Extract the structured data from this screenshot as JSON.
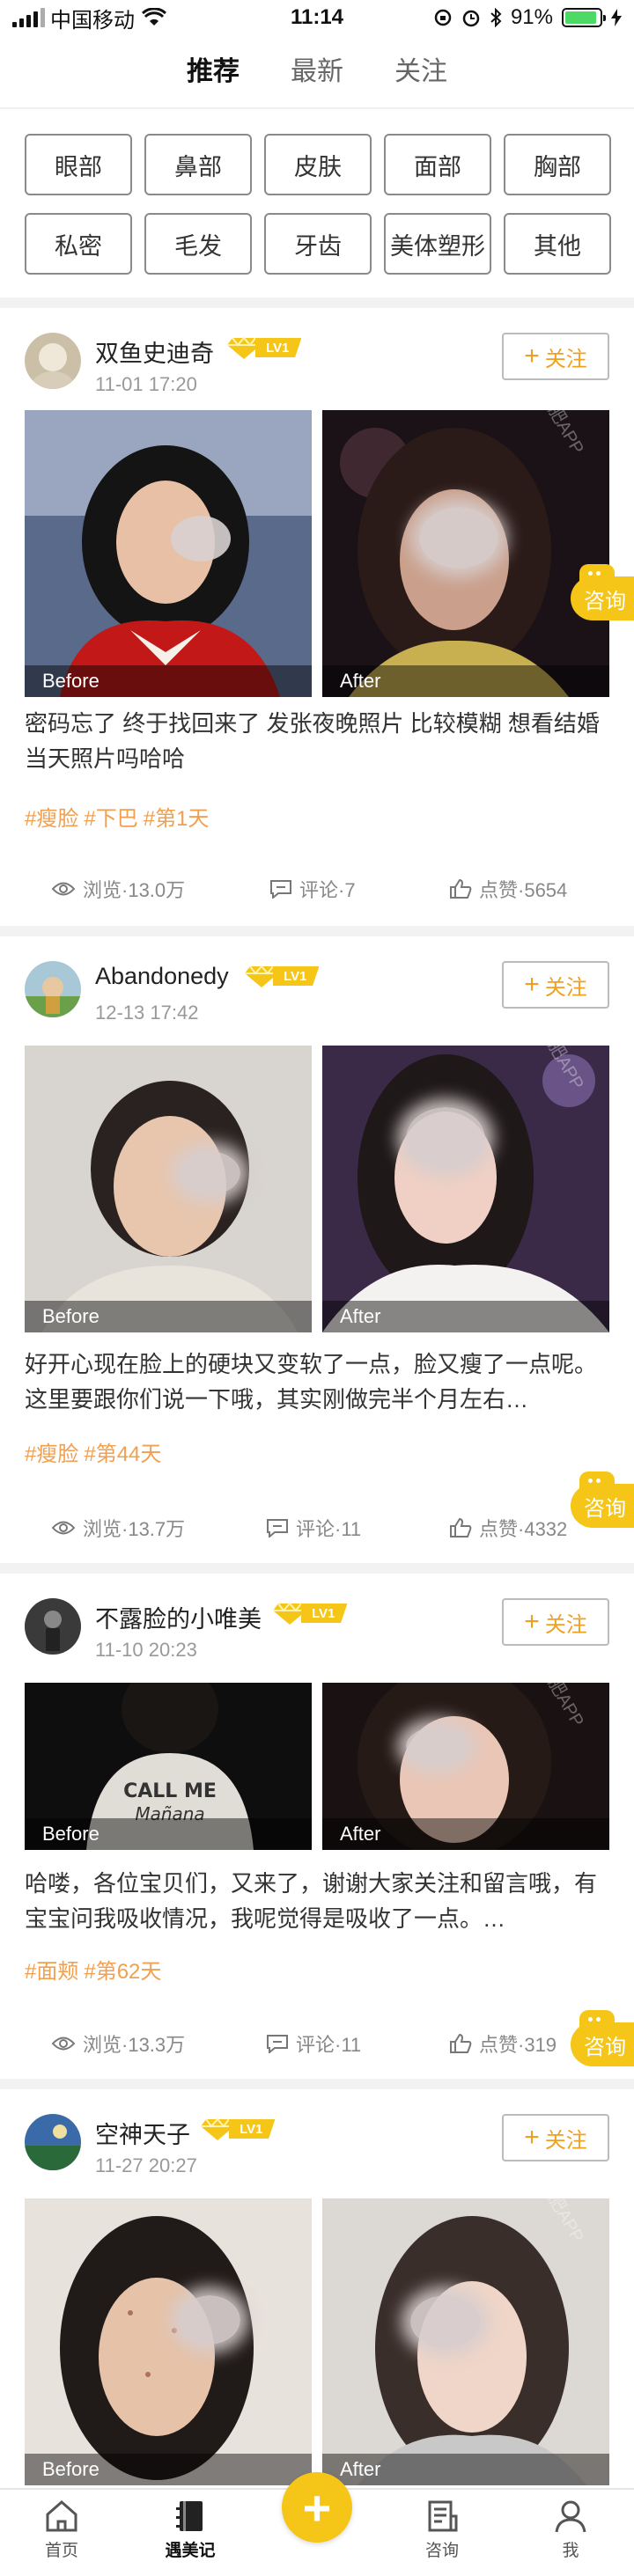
{
  "status_bar": {
    "carrier": "中国移动",
    "time": "11:14",
    "battery": "91%",
    "battery_level": 0.91
  },
  "tabs": [
    {
      "label": "推荐",
      "active": true
    },
    {
      "label": "最新"
    },
    {
      "label": "关注"
    }
  ],
  "categories": [
    "眼部",
    "鼻部",
    "皮肤",
    "面部",
    "胸部",
    "私密",
    "毛发",
    "牙齿",
    "美体塑形",
    "其他"
  ],
  "labels": {
    "before": "Before",
    "after": "After",
    "follow": "关注",
    "consult": "咨询",
    "view_prefix": "浏览·",
    "comment_prefix": "评论·",
    "like_prefix": "点赞·",
    "watermark": "天天减肥APP"
  },
  "level_badge": "LV1",
  "posts": [
    {
      "user": "双鱼史迪奇",
      "date": "11-01 17:20",
      "text": "密码忘了 终于找回来了 发张夜晚照片 比较模糊 想看结婚当天照片吗哈哈",
      "tags": [
        "#瘦脸",
        "#下巴",
        "#第1天"
      ],
      "views": "13.0万",
      "comments": "7",
      "likes": "5654"
    },
    {
      "user": "Abandonedy",
      "date": "12-13 17:42",
      "text": "好开心现在脸上的硬块又变软了一点，脸又瘦了一点呢。这里要跟你们说一下哦，其实刚做完半个月左右…",
      "tags": [
        "#瘦脸",
        "#第44天"
      ],
      "views": "13.7万",
      "comments": "11",
      "likes": "4332"
    },
    {
      "user": "不露脸的小唯美",
      "date": "11-10 20:23",
      "text": "哈喽，各位宝贝们，又来了，谢谢大家关注和留言哦，有宝宝问我吸收情况，我呢觉得是吸收了一点。…",
      "tags": [
        "#面颊",
        "#第62天"
      ],
      "views": "13.3万",
      "comments": "11",
      "likes": "319"
    },
    {
      "user": "空神天子",
      "date": "11-27 20:27"
    }
  ],
  "bottom_nav": [
    {
      "label": "首页"
    },
    {
      "label": "遇美记",
      "active": true
    },
    {
      "label": "咨询"
    },
    {
      "label": "我"
    }
  ],
  "colors": {
    "accent": "#f5c518",
    "tag": "#f0a050"
  }
}
